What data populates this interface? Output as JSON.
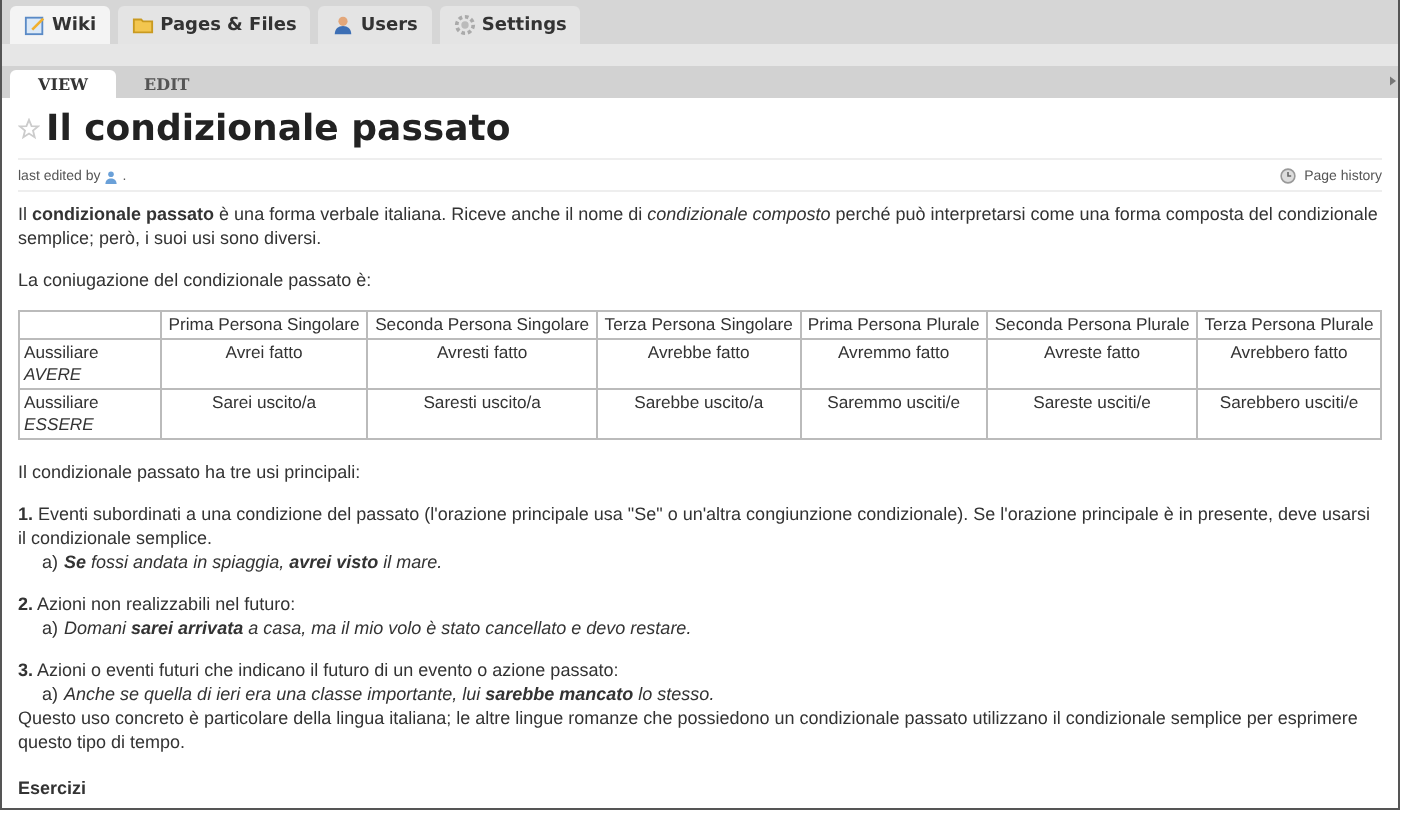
{
  "tabs": [
    {
      "label": "Wiki",
      "selected": true
    },
    {
      "label": "Pages & Files",
      "selected": false
    },
    {
      "label": "Users",
      "selected": false
    },
    {
      "label": "Settings",
      "selected": false
    }
  ],
  "subtabs": [
    {
      "label": "VIEW",
      "selected": true
    },
    {
      "label": "EDIT",
      "selected": false
    }
  ],
  "page": {
    "title": "Il condizionale passato",
    "edited_label": "last edited by",
    "edited_suffix": ".",
    "history_link": "Page history"
  },
  "intro": "Il **condizionale passato** è una forma verbale italiana. Riceve anche il nome di *condizionale composto* perché può interpretarsi come una forma composta del condizionale semplice; però, i suoi usi sono diversi.",
  "table_intro": "La coniugazione del condizionale passato è:",
  "table": {
    "columns": [
      "",
      "Prima Persona Singolare",
      "Seconda Persona Singolare",
      "Terza Persona Singolare",
      "Prima Persona Plurale",
      "Seconda Persona Plurale",
      "Terza Persona Plurale"
    ],
    "rows": [
      [
        "Aussiliare *AVERE*",
        "Avrei fatto",
        "Avresti fatto",
        "Avrebbe fatto",
        "Avremmo fatto",
        "Avreste fatto",
        "Avrebbero fatto"
      ],
      [
        "Aussiliare *ESSERE*",
        "Sarei uscito/a",
        "Saresti uscito/a",
        "Sarebbe uscito/a",
        "Saremmo usciti/e",
        "Sareste usciti/e",
        "Sarebbero usciti/e"
      ]
    ]
  },
  "uses_intro": "Il condizionale passato ha tre usi principali:",
  "uses": [
    {
      "text": "**1.** Eventi subordinati a una condizione del passato (l'orazione principale usa \"Se\" o un'altra congiunzione condizionale). Se l'orazione principale è in presente, deve usarsi il condizionale semplice.",
      "marker": "a)",
      "example": "**Se** fossi andata in spiaggia, **avrei visto** il mare."
    },
    {
      "text": "**2.** Azioni non realizzabili nel futuro:",
      "marker": "a)",
      "example": "Domani **sarei arrivata** a casa, ma il mio volo è stato cancellato e devo restare."
    },
    {
      "text": "**3.** Azioni o eventi futuri che indicano il futuro di un evento o azione passato:",
      "marker": "a)",
      "example": "Anche se quella di ieri era una classe importante, lui **sarebbe mancato** lo stesso."
    }
  ],
  "closing": "Questo uso concreto è particolare della lingua italiana; le altre lingue romanze che possiedono un condizionale passato utilizzano il condizionale semplice per esprimere questo tipo di tempo.",
  "section_heading": "Esercizi"
}
